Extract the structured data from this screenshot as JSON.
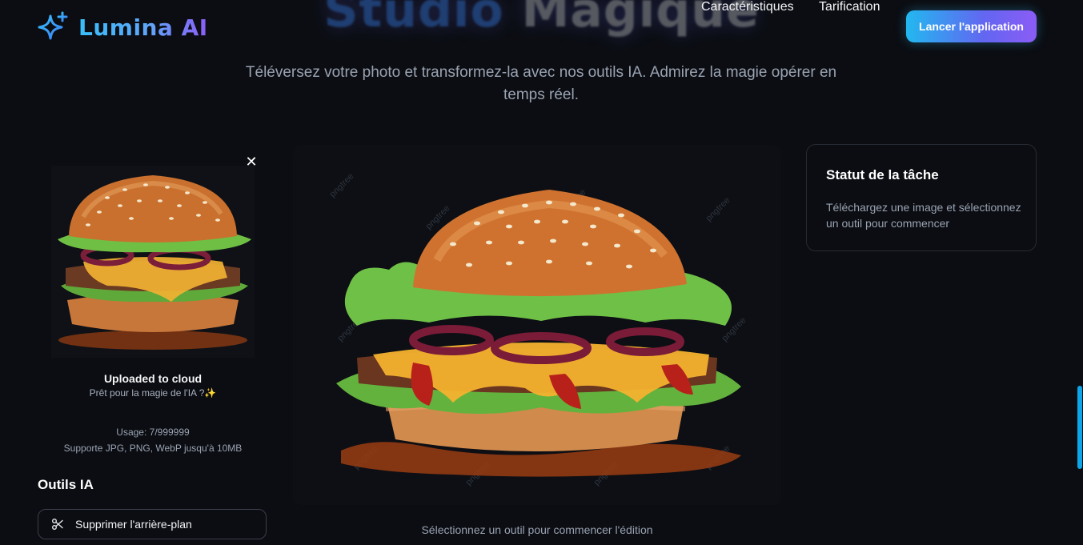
{
  "brand": {
    "name": "Lumina AI",
    "logo_icon": "sparkles-icon"
  },
  "hero": {
    "title_part1": "Studio",
    "title_part2": "Magique"
  },
  "nav": {
    "links": [
      "Caractéristiques",
      "Tarification"
    ],
    "cta_label": "Lancer l'application"
  },
  "subtitle": "Téléversez votre photo et transformez-la avec nos outils IA. Admirez la magie opérer en temps réel.",
  "upload": {
    "status_title": "Uploaded to cloud",
    "status_subtitle": "Prêt pour la magie de l'IA ?✨",
    "usage": "Usage: 7/999999",
    "formats": "Supporte JPG, PNG, WebP jusqu'à 10MB",
    "close_icon": "close-icon"
  },
  "tools": {
    "title": "Outils IA",
    "items": [
      {
        "label": "Supprimer l'arrière-plan",
        "icon": "scissors-icon"
      }
    ]
  },
  "preview": {
    "caption": "Sélectionnez un outil pour commencer l'édition"
  },
  "task_status": {
    "title": "Statut de la tâche",
    "text": "Téléchargez une image et sélectionnez un outil pour commencer"
  },
  "colors": {
    "background": "#0b0d12",
    "accent_start": "#22b8f0",
    "accent_end": "#8b5cf6",
    "muted_text": "#9aa3b2"
  }
}
